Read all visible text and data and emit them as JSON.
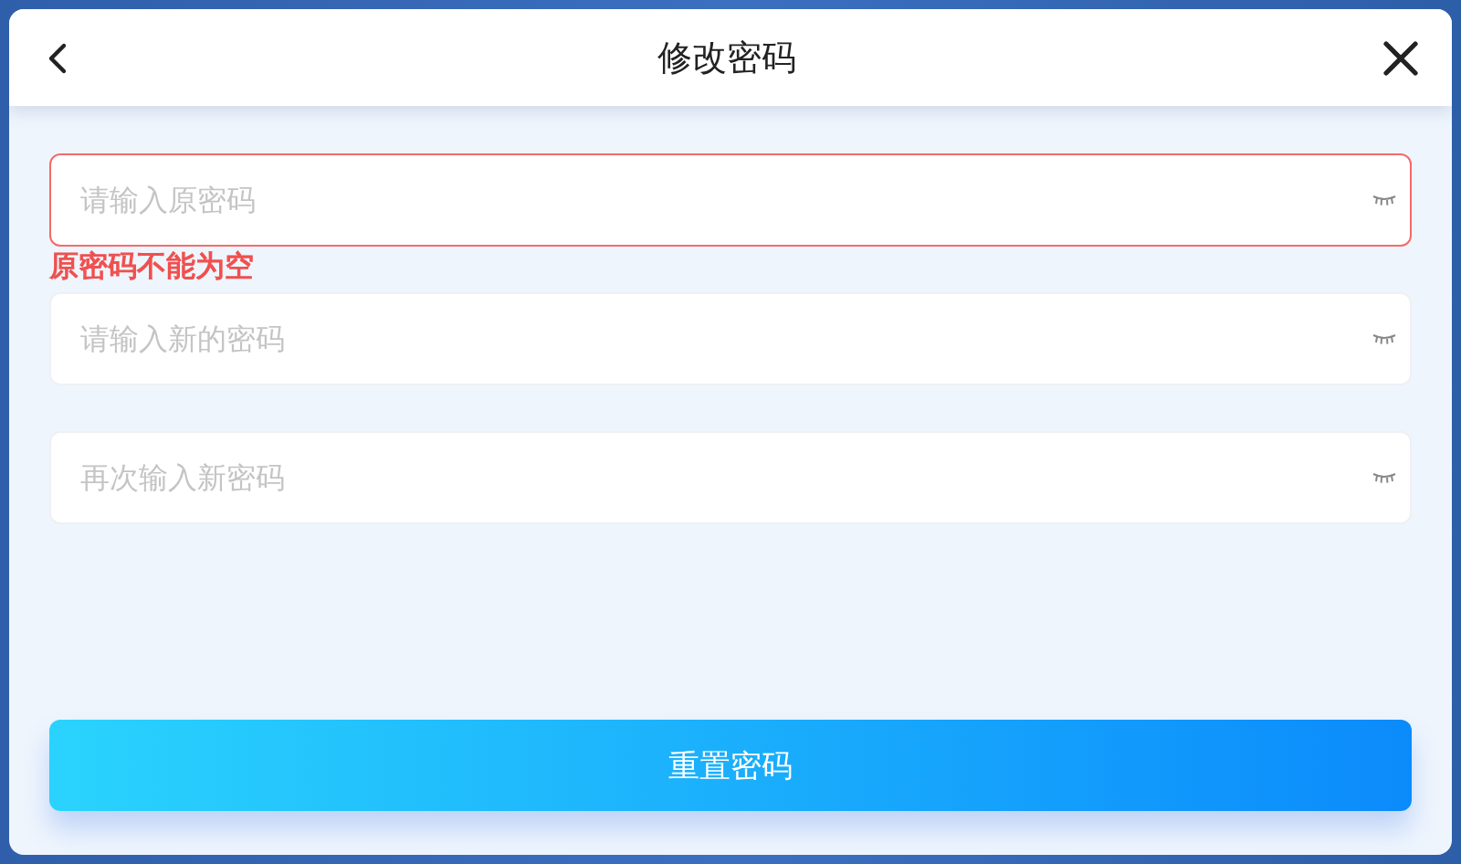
{
  "header": {
    "title": "修改密码"
  },
  "fields": [
    {
      "placeholder": "请输入原密码",
      "error": true,
      "error_message": "原密码不能为空",
      "password_visible": false
    },
    {
      "placeholder": "请输入新的密码",
      "error": false,
      "password_visible": false
    },
    {
      "placeholder": "再次输入新密码",
      "error": false,
      "password_visible": false
    }
  ],
  "submit_button": {
    "label": "重置密码"
  }
}
